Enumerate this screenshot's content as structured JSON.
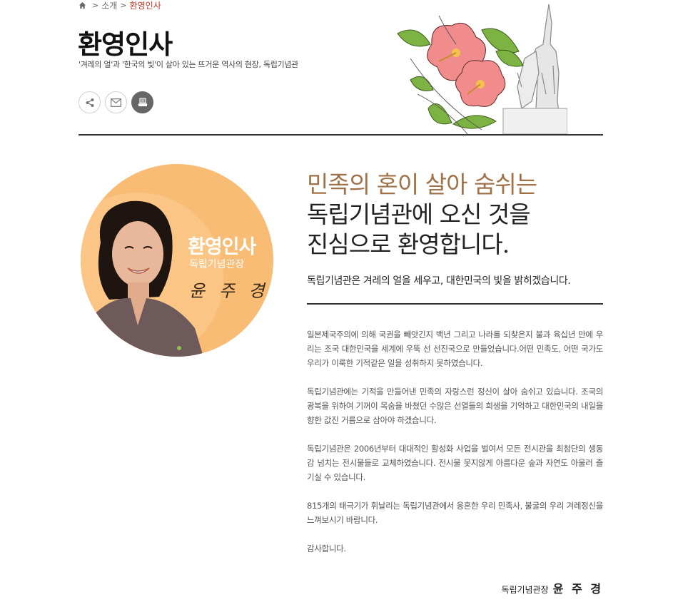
{
  "breadcrumb": {
    "home_icon": "home-icon",
    "items": [
      "소개",
      "환영인사"
    ]
  },
  "header": {
    "title": "환영인사",
    "subtitle": "'겨레의 얼'과 '한국의 빛'이 살아 있는 뜨거운 역사의 현장, 독립기념관"
  },
  "share_buttons": [
    {
      "icon": "share-icon"
    },
    {
      "icon": "mail-icon"
    },
    {
      "icon": "print-icon"
    }
  ],
  "portrait": {
    "title": "환영인사",
    "role": "독립기념관장",
    "signature": "윤 주 경",
    "colors": {
      "background": "#f9bc75"
    }
  },
  "headline": {
    "line1": "민족의 혼이 살아 숨쉬는",
    "line2": "독립기념관에 오신 것을",
    "line3": "진심으로 환영합니다."
  },
  "lead": "독립기념관은 겨레의 얼을 세우고, 대한민국의 빛을 밝히겠습니다.",
  "body": {
    "paragraphs": [
      "일본제국주의에 의해 국권을 빼앗긴지 백년 그리고 나라를 되찾은지 불과 육십년 만에 우리는 조국 대한민국을 세계에 우뚝 선 선진국으로 만들었습니다.어떤 민족도, 어떤 국가도 우리가 이룩한 기적같은 일을 성취하지 못하였습니다.",
      "독립기념관에는 기적을 만들어낸 민족의 자랑스런 정신이 살아 숨쉬고 있습니다. 조국의 광복을 위하여 기꺼이 목숨을 바쳤던 수많은 선열들의 희생을 기억하고 대한민국의 내일을 향한 값진 거름으로 삼아야 하겠습니다.",
      "독립기념관은 2006년부터 대대적인 활성화 사업을 벌여서 모든 전시관을 최첨단의 생동감 넘치는 전시물들로 교체하였습니다. 전시물 못지않게 아름다운 숲과 자연도 아울러 즐기실 수 있습니다.",
      "815개의 태극기가 휘날리는 독립기념관에서 웅혼한 우리 민족사, 불굴의 우리 겨레정신을 느껴보시기 바랍니다.",
      "감사합니다."
    ]
  },
  "signature": {
    "role": "독립기념관장",
    "name": "윤 주 경"
  },
  "colors": {
    "accent": "#c0392b",
    "headline_brown": "#a0724a",
    "rule": "#333333"
  }
}
